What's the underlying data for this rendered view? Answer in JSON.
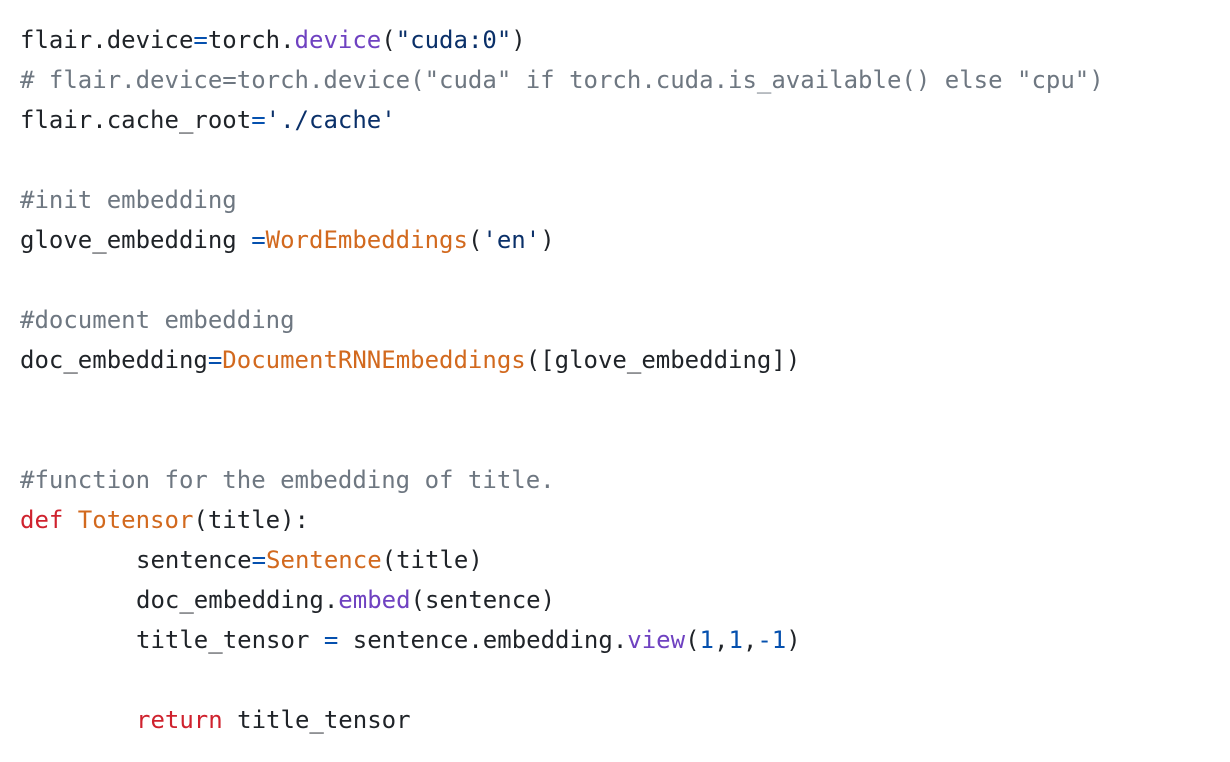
{
  "colors": {
    "background": "#ffffff",
    "plain": "#1f2328",
    "comment": "#6e7781",
    "keyword": "#cf222e",
    "function": "#d2691e",
    "method": "#6f42c1",
    "string": "#0a3069",
    "number": "#0550ae",
    "operator": "#0550ae"
  },
  "lines": [
    {
      "indent": false,
      "tokens": [
        {
          "t": "plain",
          "v": "flair.device"
        },
        {
          "t": "operator",
          "v": "="
        },
        {
          "t": "plain",
          "v": "torch."
        },
        {
          "t": "method",
          "v": "device"
        },
        {
          "t": "plain",
          "v": "("
        },
        {
          "t": "string",
          "v": "\"cuda:0\""
        },
        {
          "t": "plain",
          "v": ")"
        }
      ]
    },
    {
      "indent": false,
      "tokens": [
        {
          "t": "comment",
          "v": "# flair.device=torch.device(\"cuda\" if torch.cuda.is_available() else \"cpu\")"
        }
      ]
    },
    {
      "indent": false,
      "tokens": [
        {
          "t": "plain",
          "v": "flair.cache_root"
        },
        {
          "t": "operator",
          "v": "="
        },
        {
          "t": "string",
          "v": "'./cache'"
        }
      ]
    },
    {
      "indent": false,
      "tokens": []
    },
    {
      "indent": false,
      "tokens": [
        {
          "t": "comment",
          "v": "#init embedding"
        }
      ]
    },
    {
      "indent": false,
      "tokens": [
        {
          "t": "plain",
          "v": "glove_embedding "
        },
        {
          "t": "operator",
          "v": "="
        },
        {
          "t": "func",
          "v": "WordEmbeddings"
        },
        {
          "t": "plain",
          "v": "("
        },
        {
          "t": "string",
          "v": "'en'"
        },
        {
          "t": "plain",
          "v": ")"
        }
      ]
    },
    {
      "indent": false,
      "tokens": []
    },
    {
      "indent": false,
      "tokens": [
        {
          "t": "comment",
          "v": "#document embedding"
        }
      ]
    },
    {
      "indent": false,
      "tokens": [
        {
          "t": "plain",
          "v": "doc_embedding"
        },
        {
          "t": "operator",
          "v": "="
        },
        {
          "t": "func",
          "v": "DocumentRNNEmbeddings"
        },
        {
          "t": "plain",
          "v": "([glove_embedding])"
        }
      ]
    },
    {
      "indent": false,
      "tokens": []
    },
    {
      "indent": false,
      "tokens": []
    },
    {
      "indent": false,
      "tokens": [
        {
          "t": "comment",
          "v": "#function for the embedding of title."
        }
      ]
    },
    {
      "indent": false,
      "tokens": [
        {
          "t": "keyword",
          "v": "def "
        },
        {
          "t": "func",
          "v": "Totensor"
        },
        {
          "t": "plain",
          "v": "(title):"
        }
      ]
    },
    {
      "indent": true,
      "tokens": [
        {
          "t": "plain",
          "v": "sentence"
        },
        {
          "t": "operator",
          "v": "="
        },
        {
          "t": "func",
          "v": "Sentence"
        },
        {
          "t": "plain",
          "v": "(title)"
        }
      ]
    },
    {
      "indent": true,
      "tokens": [
        {
          "t": "plain",
          "v": "doc_embedding."
        },
        {
          "t": "method",
          "v": "embed"
        },
        {
          "t": "plain",
          "v": "(sentence)"
        }
      ]
    },
    {
      "indent": true,
      "tokens": [
        {
          "t": "plain",
          "v": "title_tensor "
        },
        {
          "t": "operator",
          "v": "="
        },
        {
          "t": "plain",
          "v": " sentence.embedding."
        },
        {
          "t": "method",
          "v": "view"
        },
        {
          "t": "plain",
          "v": "("
        },
        {
          "t": "number",
          "v": "1"
        },
        {
          "t": "plain",
          "v": ","
        },
        {
          "t": "number",
          "v": "1"
        },
        {
          "t": "plain",
          "v": ","
        },
        {
          "t": "number",
          "v": "-1"
        },
        {
          "t": "plain",
          "v": ")"
        }
      ]
    },
    {
      "indent": false,
      "tokens": []
    },
    {
      "indent": true,
      "tokens": [
        {
          "t": "keyword",
          "v": "return"
        },
        {
          "t": "plain",
          "v": " title_tensor"
        }
      ]
    }
  ]
}
